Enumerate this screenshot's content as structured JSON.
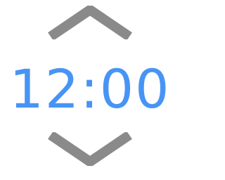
{
  "stepper": {
    "value": "12:00",
    "accent_color": "#3f8ff5",
    "arrow_color": "#8a8a8a",
    "increment_icon": "chevron-up-icon",
    "decrement_icon": "chevron-down-icon"
  }
}
